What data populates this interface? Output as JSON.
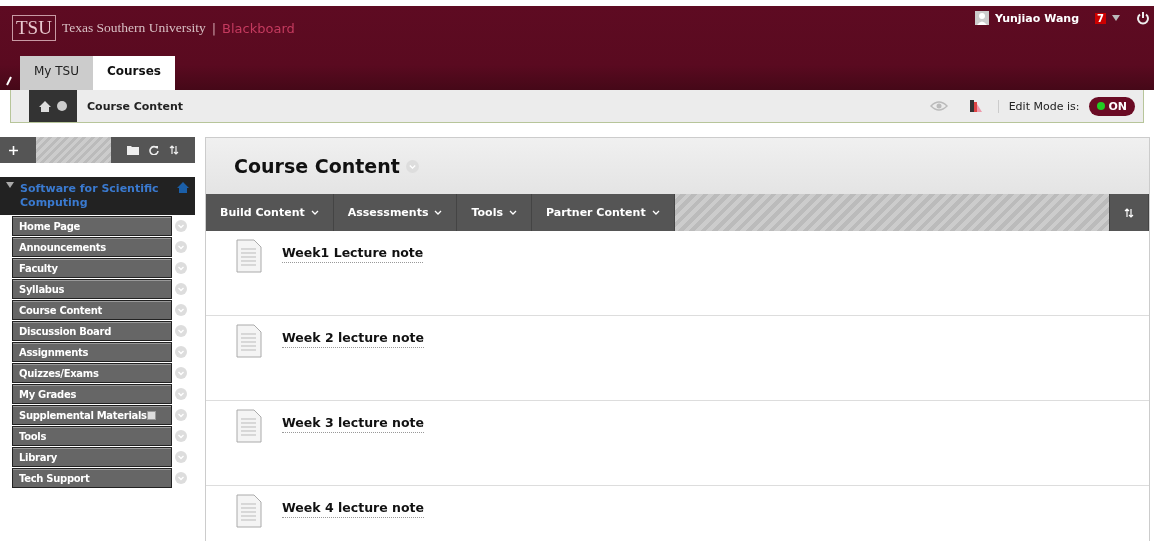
{
  "header": {
    "logo": "TSU",
    "institution": "Texas Southern University",
    "separator": "|",
    "product": "Blackboard",
    "user": "Yunjiao Wang",
    "notifications": "7"
  },
  "tabs": [
    {
      "label": "My TSU",
      "selected": false
    },
    {
      "label": "Courses",
      "selected": true
    }
  ],
  "breadcrumb": "Course Content",
  "edit_mode": {
    "label": "Edit Mode is:",
    "value": "ON",
    "on": true
  },
  "course": {
    "title": "Software for Scientific Computing",
    "menu": [
      {
        "label": "Home Page",
        "badge": false
      },
      {
        "label": "Announcements",
        "badge": false
      },
      {
        "label": "Faculty",
        "badge": false
      },
      {
        "label": "Syllabus",
        "badge": false
      },
      {
        "label": "Course Content",
        "badge": false
      },
      {
        "label": "Discussion Board",
        "badge": false
      },
      {
        "label": "Assignments",
        "badge": false
      },
      {
        "label": "Quizzes/Exams",
        "badge": false
      },
      {
        "label": "My Grades",
        "badge": false
      },
      {
        "label": "Supplemental Materials",
        "badge": true
      },
      {
        "label": "Tools",
        "badge": false
      },
      {
        "label": "Library",
        "badge": false
      },
      {
        "label": "Tech Support",
        "badge": false
      }
    ]
  },
  "page_title": "Course Content",
  "action_bar": [
    "Build Content",
    "Assessments",
    "Tools",
    "Partner Content"
  ],
  "items": [
    {
      "title": "Week1 Lecture note"
    },
    {
      "title": "Week 2 lecture note"
    },
    {
      "title": "Week 3 lecture note"
    },
    {
      "title": "Week 4 lecture note"
    }
  ]
}
